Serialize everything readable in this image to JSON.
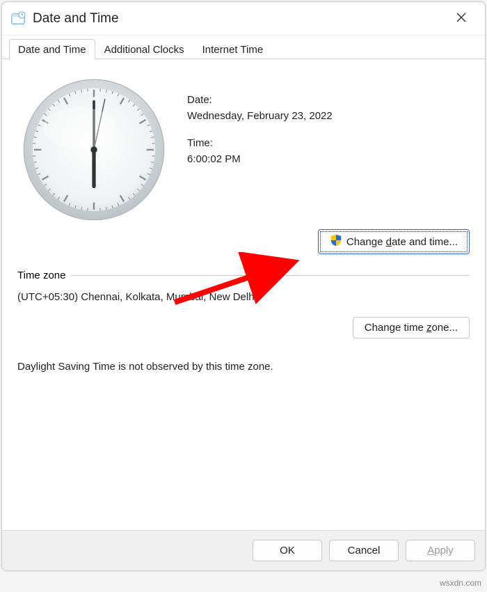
{
  "window": {
    "title": "Date and Time"
  },
  "tabs": [
    {
      "label": "Date and Time",
      "active": true
    },
    {
      "label": "Additional Clocks",
      "active": false
    },
    {
      "label": "Internet Time",
      "active": false
    }
  ],
  "date_section": {
    "date_label": "Date:",
    "date_value": "Wednesday, February 23, 2022",
    "time_label": "Time:",
    "time_value": "6:00:02 PM",
    "change_btn_prefix": "Change ",
    "change_btn_u": "d",
    "change_btn_suffix": "ate and time..."
  },
  "timezone_section": {
    "group_label": "Time zone",
    "value": "(UTC+05:30) Chennai, Kolkata, Mumbai, New Delhi",
    "change_btn_prefix": "Change time ",
    "change_btn_u": "z",
    "change_btn_suffix": "one..."
  },
  "dst_note": "Daylight Saving Time is not observed by this time zone.",
  "footer": {
    "ok": "OK",
    "cancel": "Cancel",
    "apply_u": "A",
    "apply_rest": "pply"
  },
  "watermark": "wsxdn.com",
  "clock": {
    "hour": 6,
    "minute": 0,
    "second": 2
  },
  "icons": {
    "shield": "shield-icon",
    "clock": "clock-icon",
    "close": "close-icon"
  }
}
